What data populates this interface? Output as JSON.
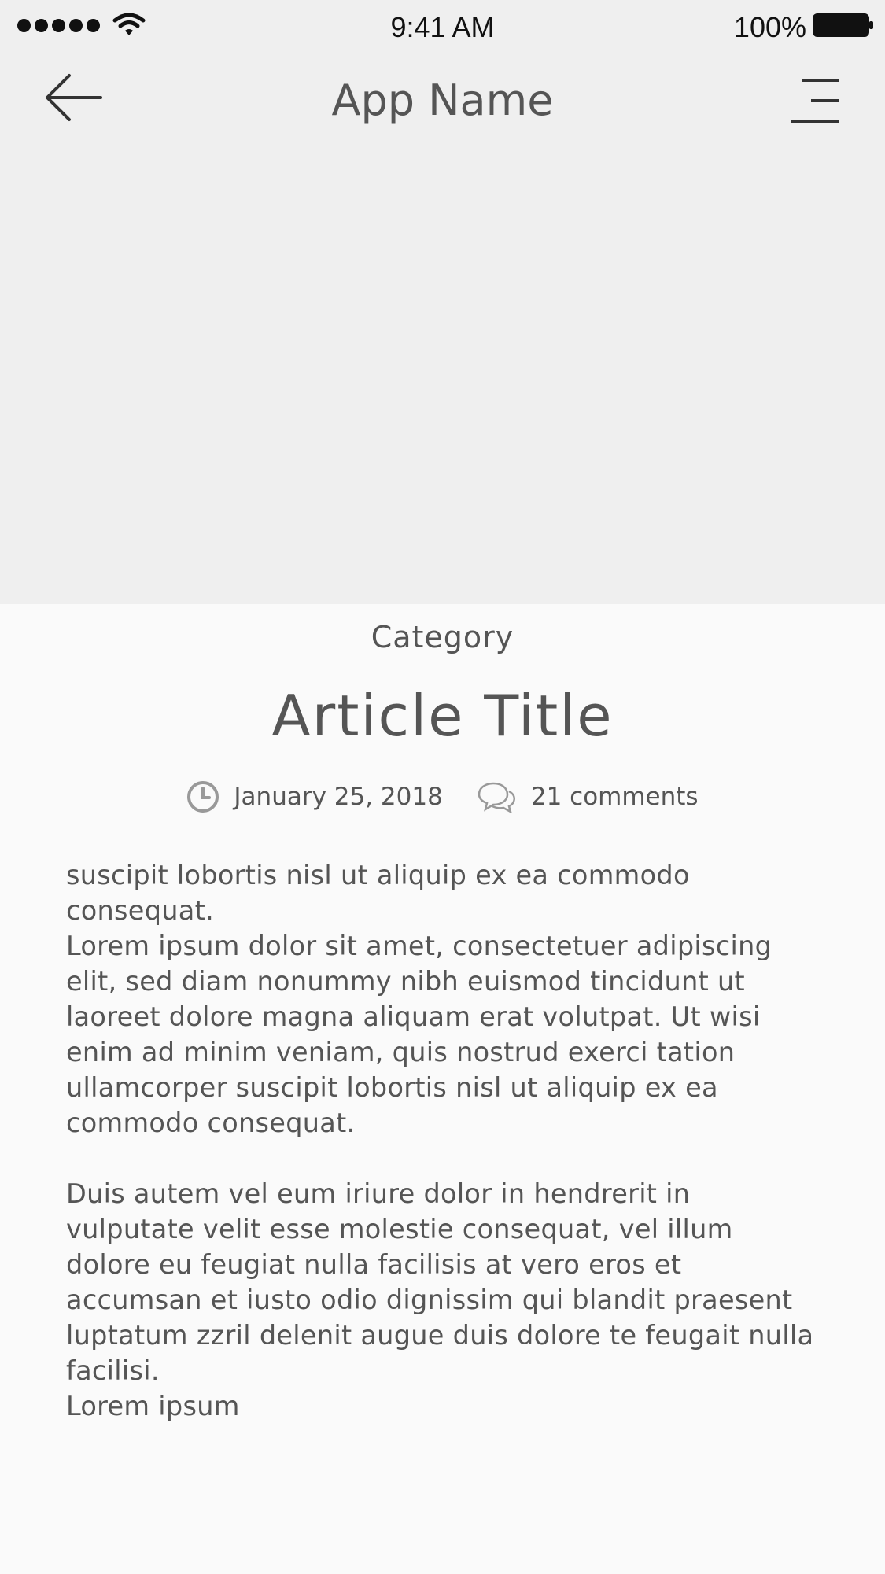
{
  "status_bar": {
    "time": "9:41 AM",
    "battery_percent": "100%",
    "icons": [
      "signal-dots-icon",
      "wifi-icon",
      "battery-icon"
    ]
  },
  "nav": {
    "title": "App Name",
    "back_icon": "arrow-left-icon",
    "menu_icon": "menu-icon"
  },
  "article": {
    "category": "Category",
    "title": "Article Title",
    "date": "January 25, 2018",
    "comments": "21 comments",
    "body": [
      "suscipit lobortis nisl ut aliquip ex ea commodo consequat.",
      "Lorem ipsum dolor sit amet, consectetuer adipiscing elit, sed diam nonummy nibh euismod tincidunt ut laoreet dolore magna aliquam erat volutpat. Ut wisi enim ad minim veniam, quis nostrud exerci tation ullamcorper suscipit lobortis nisl ut aliquip ex ea commodo consequat.",
      "Duis autem vel eum iriure dolor in hendrerit in vulputate velit esse molestie consequat, vel illum dolore eu feugiat nulla facilisis at vero eros et accumsan et iusto odio dignissim qui blandit praesent luptatum zzril delenit augue duis dolore te feugait nulla facilisi.",
      "Lorem ipsum"
    ]
  },
  "colors": {
    "hero_background": "#efefef",
    "page_background": "#fafafa",
    "text": "#555555",
    "icon": "#999999"
  }
}
